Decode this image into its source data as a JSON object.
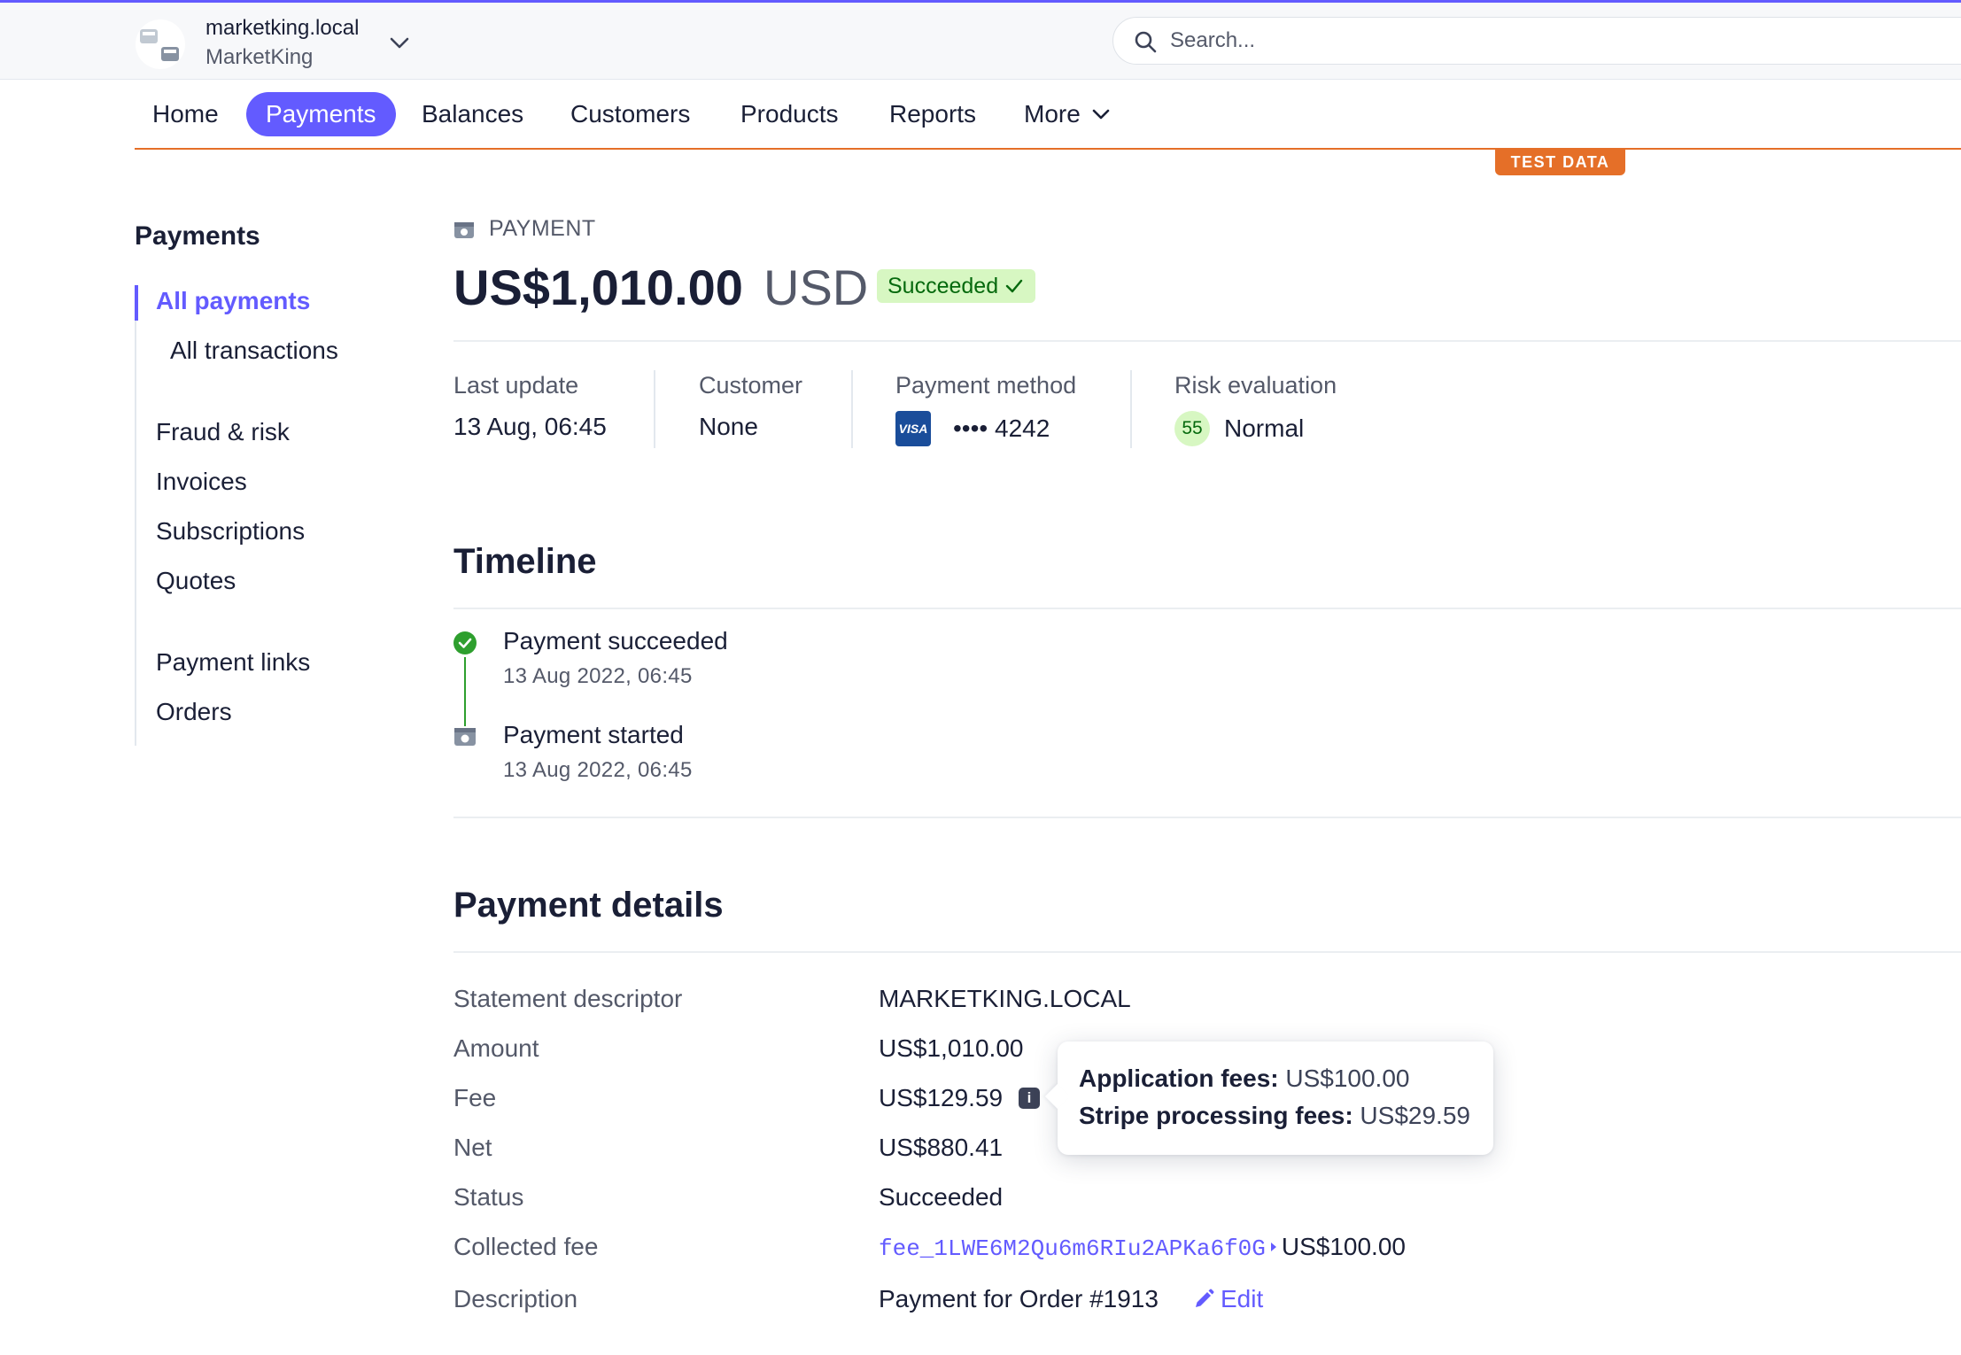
{
  "account": {
    "domain": "marketking.local",
    "name": "MarketKing"
  },
  "search": {
    "placeholder": "Search..."
  },
  "nav": {
    "items": [
      {
        "label": "Home"
      },
      {
        "label": "Payments"
      },
      {
        "label": "Balances"
      },
      {
        "label": "Customers"
      },
      {
        "label": "Products"
      },
      {
        "label": "Reports"
      },
      {
        "label": "More"
      }
    ],
    "active": "Payments",
    "test_badge": "TEST DATA"
  },
  "sidebar": {
    "title": "Payments",
    "items": [
      {
        "label": "All payments"
      },
      {
        "label": "All transactions"
      },
      {
        "label": "Fraud & risk"
      },
      {
        "label": "Invoices"
      },
      {
        "label": "Subscriptions"
      },
      {
        "label": "Quotes"
      },
      {
        "label": "Payment links"
      },
      {
        "label": "Orders"
      }
    ]
  },
  "payment": {
    "kicker": "PAYMENT",
    "amount": "US$1,010.00",
    "currency": "USD",
    "status": "Succeeded"
  },
  "meta": {
    "last_update_label": "Last update",
    "last_update_value": "13 Aug, 06:45",
    "customer_label": "Customer",
    "customer_value": "None",
    "payment_method_label": "Payment method",
    "card_brand": "VISA",
    "card_number": "•••• 4242",
    "risk_label": "Risk evaluation",
    "risk_score": "55",
    "risk_value": "Normal"
  },
  "timeline": {
    "title": "Timeline",
    "events": [
      {
        "title": "Payment succeeded",
        "time": "13 Aug 2022, 06:45"
      },
      {
        "title": "Payment started",
        "time": "13 Aug 2022, 06:45"
      }
    ]
  },
  "details": {
    "title": "Payment details",
    "rows": [
      {
        "label": "Statement descriptor",
        "value": "MARKETKING.LOCAL"
      },
      {
        "label": "Amount",
        "value": "US$1,010.00"
      },
      {
        "label": "Fee",
        "value": "US$129.59"
      },
      {
        "label": "Net",
        "value": "US$880.41"
      },
      {
        "label": "Status",
        "value": "Succeeded"
      },
      {
        "label": "Collected fee",
        "link": "fee_1LWE6M2Qu6m6RIu2APKa6f0G",
        "value": "US$100.00"
      },
      {
        "label": "Description",
        "value": "Payment for Order #1913"
      }
    ],
    "edit_label": "Edit"
  },
  "tooltip": {
    "line1_label": "Application fees:",
    "line1_value": " US$100.00",
    "line2_label": "Stripe processing fees:",
    "line2_value": " US$29.59"
  },
  "colors": {
    "accent": "#635bff",
    "test_orange": "#e56f28",
    "success_bg": "#d7f7c2",
    "success_text": "#05690d"
  }
}
